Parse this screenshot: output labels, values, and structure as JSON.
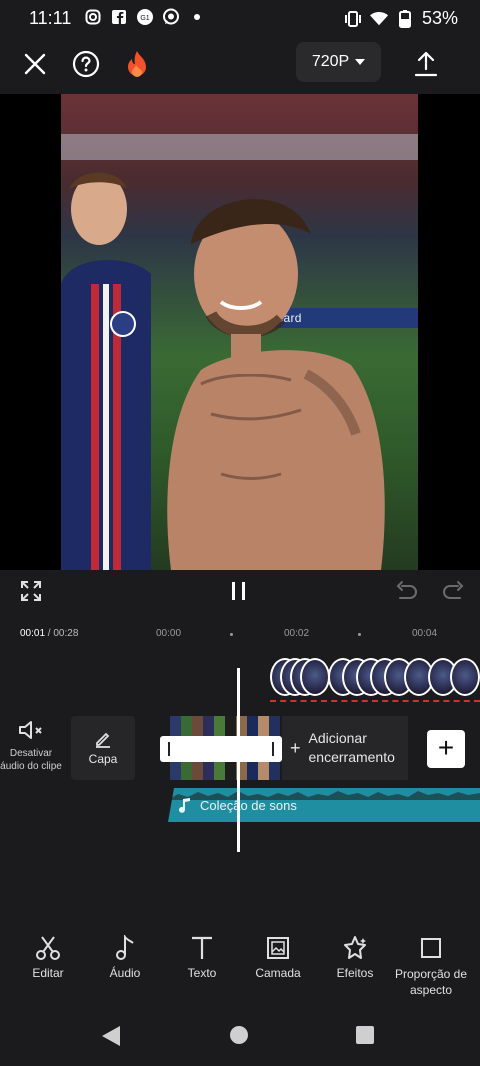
{
  "status_bar": {
    "time": "11:11",
    "battery": "53%",
    "icons": [
      "instagram-icon",
      "facebook-icon",
      "notification-icon",
      "whatsapp-icon",
      "dot-icon"
    ]
  },
  "top_bar": {
    "resolution_label": "720P"
  },
  "timeline": {
    "current_time": "00:01",
    "total_time": " / 00:28",
    "ticks": [
      "00:00",
      "00:02",
      "00:04"
    ]
  },
  "clip_controls": {
    "mute_label": "Desativar áudio do clipe",
    "cover_label": "Capa",
    "add_ending_label": "Adicionar encerramento"
  },
  "audio": {
    "track_label": "Coleção de sons"
  },
  "video": {
    "ad_board_text": "astercard"
  },
  "toolbar": {
    "items": [
      {
        "label": "Editar",
        "icon": "scissors-icon"
      },
      {
        "label": "Áudio",
        "icon": "music-note-icon"
      },
      {
        "label": "Texto",
        "icon": "text-icon"
      },
      {
        "label": "Camada",
        "icon": "layer-image-icon"
      },
      {
        "label": "Efeitos",
        "icon": "effects-star-icon"
      },
      {
        "label": "Proporção de aspecto",
        "icon": "aspect-ratio-icon"
      }
    ]
  },
  "colors": {
    "background": "#1b1b1d",
    "audio_track": "#1f8ea1",
    "fire_accent": "#f0532b"
  }
}
